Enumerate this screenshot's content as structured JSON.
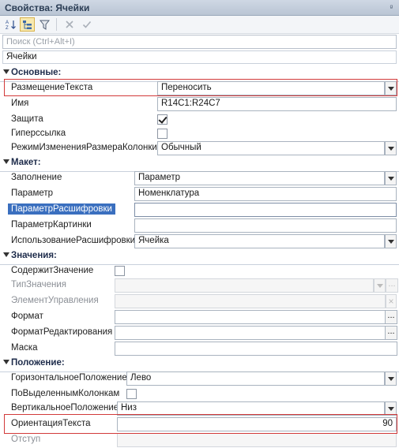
{
  "window": {
    "title": "Свойства: Ячейки",
    "pin_glyph": "ᵍ"
  },
  "toolbar": {
    "icons": [
      "sort-az-icon",
      "tree-view-icon",
      "filter-icon",
      "delete-icon",
      "check-icon"
    ]
  },
  "search": {
    "placeholder": "Поиск (Ctrl+Alt+I)",
    "value": ""
  },
  "object_name": "Ячейки",
  "groups": {
    "basic": "Основные:",
    "layout": "Макет:",
    "values": "Значения:",
    "position": "Положение:"
  },
  "props": {
    "placement": {
      "label": "РазмещениеТекста",
      "value": "Переносить"
    },
    "name": {
      "label": "Имя",
      "value": "R14C1:R24C7"
    },
    "protection": {
      "label": "Защита",
      "checked": true
    },
    "hyperlink": {
      "label": "Гиперссылка",
      "checked": false
    },
    "resize_mode": {
      "label": "РежимИзмененияРазмераКолонки",
      "value": "Обычный"
    },
    "fill": {
      "label": "Заполнение",
      "value": "Параметр"
    },
    "parameter": {
      "label": "Параметр",
      "value": "Номенклатура"
    },
    "details_param": {
      "label": "ПараметрРасшифровки",
      "value": ""
    },
    "picture_param": {
      "label": "ПараметрКартинки",
      "value": ""
    },
    "details_use": {
      "label": "ИспользованиеРасшифровки",
      "value": "Ячейка"
    },
    "contains_value": {
      "label": "СодержитЗначение",
      "checked": false
    },
    "value_type": {
      "label": "ТипЗначения",
      "value": ""
    },
    "control": {
      "label": "ЭлементУправления",
      "value": ""
    },
    "format": {
      "label": "Формат",
      "value": ""
    },
    "edit_format": {
      "label": "ФорматРедактирования",
      "value": ""
    },
    "mask": {
      "label": "Маска",
      "value": ""
    },
    "h_align": {
      "label": "ГоризонтальноеПоложение",
      "value": "Лево"
    },
    "by_selected_cols": {
      "label": "ПоВыделеннымКолонкам",
      "checked": false
    },
    "v_align": {
      "label": "ВертикальноеПоложение",
      "value": "Низ"
    },
    "orientation": {
      "label": "ОриентацияТекста",
      "value": "90"
    },
    "indent": {
      "label": "Отступ",
      "value": ""
    }
  },
  "ellipsis": "...",
  "clear_glyph": "×",
  "colors": {
    "highlight": "#3a6fbf",
    "annotation": "#d23a3a",
    "group_text": "#1d2b4a"
  }
}
